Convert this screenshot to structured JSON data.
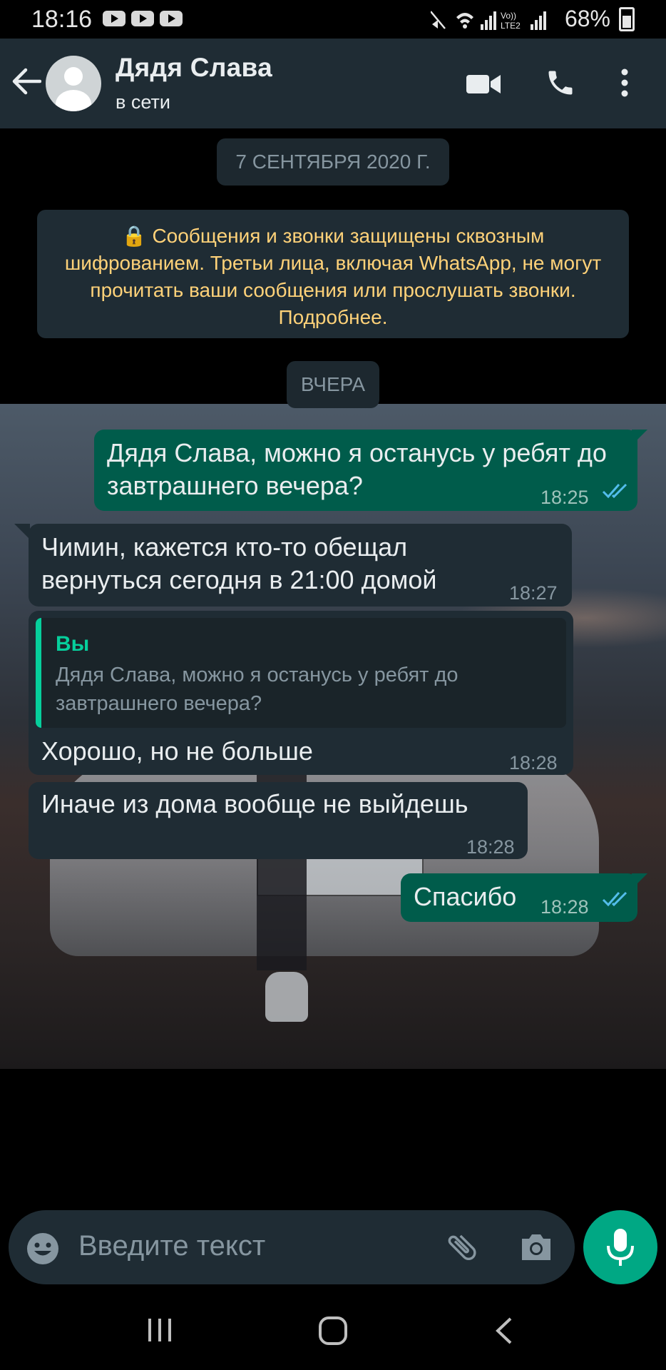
{
  "status_bar": {
    "time": "18:16",
    "battery": "68%",
    "icons": [
      "youtube-icon",
      "youtube-icon",
      "youtube-icon",
      "mute-icon",
      "wifi-icon",
      "signal-icon",
      "volte-icon",
      "signal-icon",
      "battery-icon"
    ]
  },
  "header": {
    "name": "Дядя Слава",
    "status": "в сети"
  },
  "chat": {
    "date_chip_1": "7 СЕНТЯБРЯ 2020 Г.",
    "encryption_notice": "🔒 Сообщения и звонки защищены сквозным шифрованием. Третьи лица, включая WhatsApp, не могут прочитать ваши сообщения или прослушать звонки. Подробнее.",
    "date_chip_2": "ВЧЕРА",
    "messages": [
      {
        "direction": "out",
        "text": "Дядя Слава, можно я останусь у ребят до завтрашнего вечера?",
        "time": "18:25",
        "status": "read"
      },
      {
        "direction": "in",
        "text": "Чимин, кажется кто-то обещал вернуться сегодня в 21:00 домой",
        "time": "18:27"
      },
      {
        "direction": "in",
        "quote_author": "Вы",
        "quote_text": "Дядя Слава, можно я останусь у ребят до завтрашнего вечера?",
        "text": "Хорошо, но не больше",
        "time": "18:28"
      },
      {
        "direction": "in",
        "text": "Иначе из дома вообще не выйдешь",
        "time": "18:28"
      },
      {
        "direction": "out",
        "text": "Спасибо",
        "time": "18:28",
        "status": "read"
      }
    ]
  },
  "composer": {
    "placeholder": "Введите текст"
  },
  "colors": {
    "header_bg": "#1f2c34",
    "incoming_bubble": "#1f2c34",
    "outgoing_bubble": "#005c4b",
    "accent": "#00a884",
    "read_ticks": "#53bdeb",
    "notice_text": "#ffd279"
  }
}
